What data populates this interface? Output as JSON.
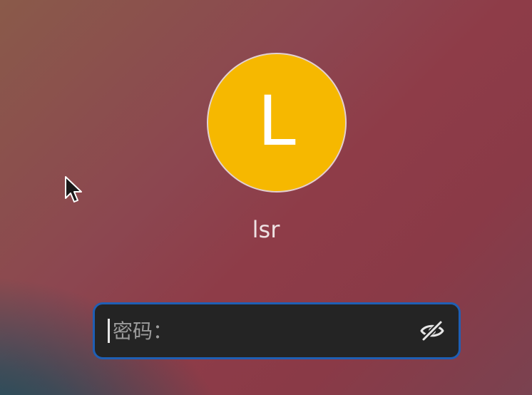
{
  "login": {
    "avatar": {
      "initial": "L",
      "color": "#f6b800"
    },
    "username": "lsr",
    "password": {
      "value": "",
      "placeholder": "密码："
    },
    "icons": {
      "visibility_toggle": "eye-slash-icon",
      "pointer": "mouse-pointer-icon"
    },
    "accent_color": "#1f5fb4"
  }
}
